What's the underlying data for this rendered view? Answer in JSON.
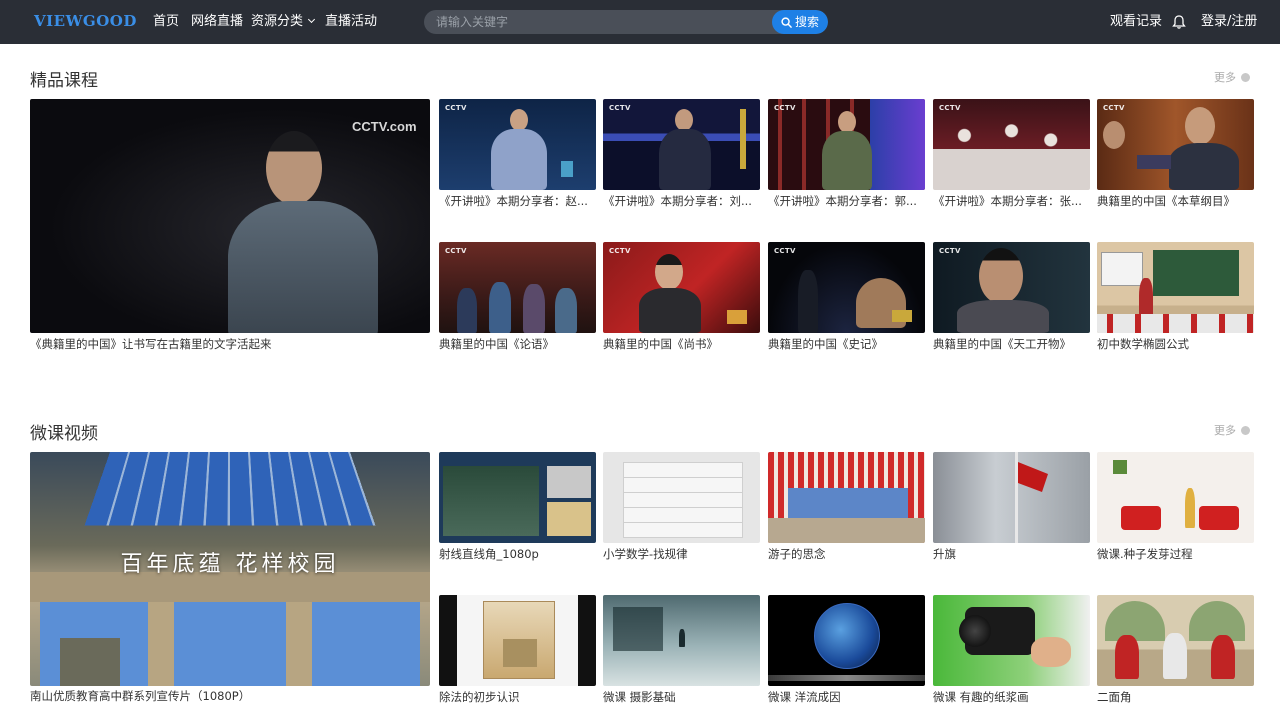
{
  "header": {
    "logo": "VIEWGOOD",
    "nav": [
      {
        "label": "首页"
      },
      {
        "label": "网络直播"
      },
      {
        "label": "资源分类"
      },
      {
        "label": "直播活动"
      }
    ],
    "search": {
      "placeholder": "请输入关键字",
      "button": "搜索"
    },
    "history": "观看记录",
    "login": "登录/注册"
  },
  "sections": [
    {
      "title": "精品课程",
      "more": "更多",
      "featured": {
        "caption": "《典籍里的中国》让书写在古籍里的文字活起来",
        "logo": "CCTV.com"
      },
      "items": [
        {
          "caption": "《开讲啦》本期分享者：赵..."
        },
        {
          "caption": "《开讲啦》本期分享者：刘..."
        },
        {
          "caption": "《开讲啦》本期分享者：郭..."
        },
        {
          "caption": "《开讲啦》本期分享者：张..."
        },
        {
          "caption": "典籍里的中国《本草纲目》"
        },
        {
          "caption": "典籍里的中国《论语》"
        },
        {
          "caption": "典籍里的中国《尚书》"
        },
        {
          "caption": "典籍里的中国《史记》"
        },
        {
          "caption": "典籍里的中国《天工开物》"
        },
        {
          "caption": "初中数学椭圆公式"
        }
      ]
    },
    {
      "title": "微课视频",
      "more": "更多",
      "featured": {
        "caption": "南山优质教育高中群系列宣传片（1080P）",
        "overlay": "百年底蕴  花样校园"
      },
      "items": [
        {
          "caption": "射线直线角_1080p"
        },
        {
          "caption": "小学数学-找规律"
        },
        {
          "caption": "游子的思念"
        },
        {
          "caption": "升旗"
        },
        {
          "caption": "微课.种子发芽过程"
        },
        {
          "caption": "除法的初步认识"
        },
        {
          "caption": "微课  摄影基础"
        },
        {
          "caption": "微课  洋流成因"
        },
        {
          "caption": "微课  有趣的纸浆画"
        },
        {
          "caption": "二面角"
        }
      ]
    }
  ],
  "cctv_small": "CCTV"
}
